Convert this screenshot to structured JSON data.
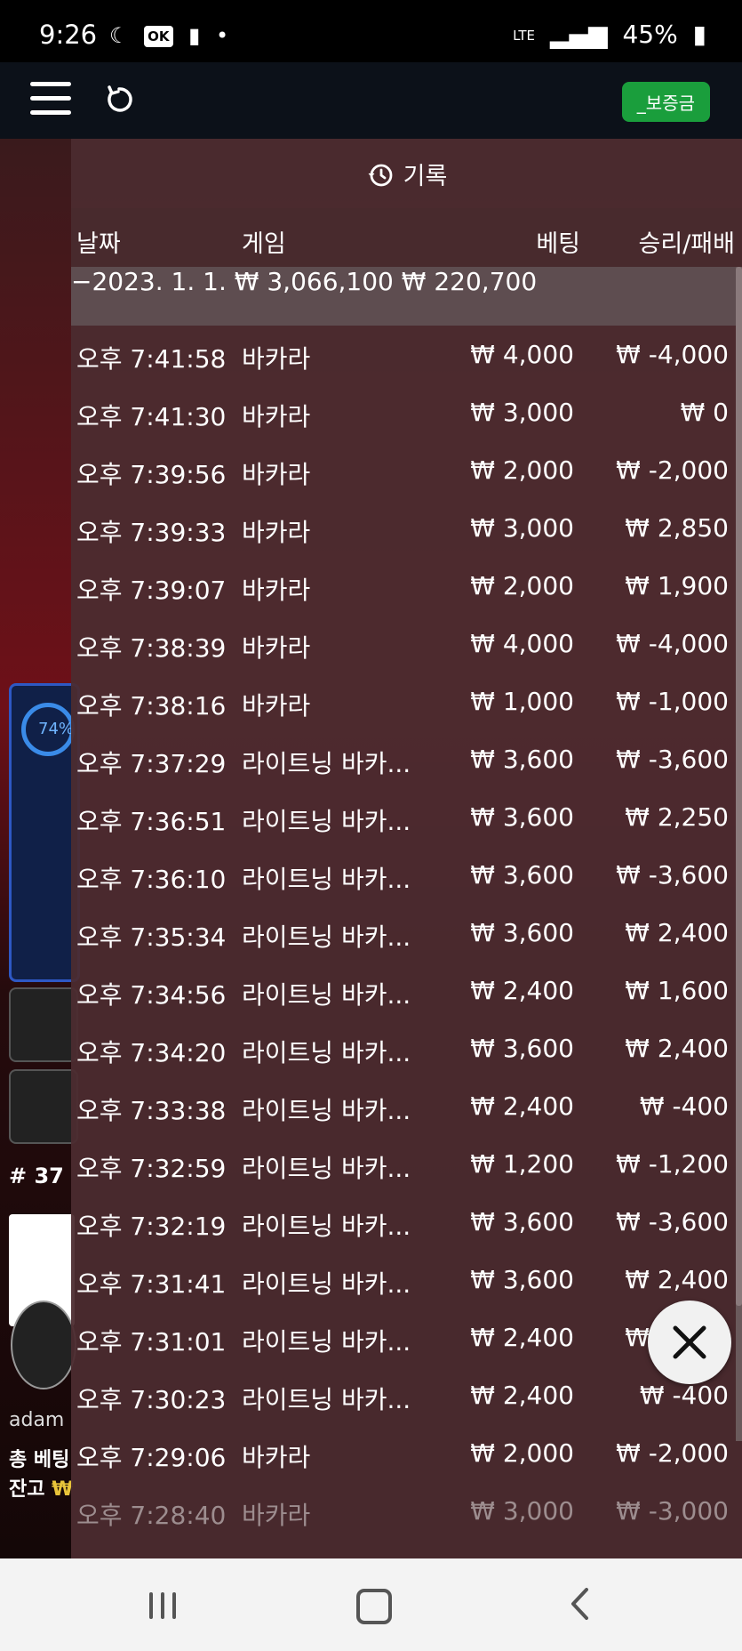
{
  "status_bar": {
    "time": "9:26",
    "icons_left": [
      "moon-icon",
      "ok-app-icon",
      "book-icon",
      "dot-icon"
    ],
    "ok_badge": "OK",
    "network": "LTE",
    "battery": "45%"
  },
  "app_bar": {
    "deposit_button": "_보증금"
  },
  "history": {
    "title": "기록",
    "columns": {
      "date": "날짜",
      "game": "게임",
      "bet": "베팅",
      "win_loss": "승리/패배"
    },
    "summary": {
      "date": "−2023. 1. 1.",
      "bet": "₩ 3,066,100",
      "win_loss": "₩ 220,700"
    },
    "rows": [
      {
        "time": "오후 7:41:58",
        "game": "바카라",
        "bet": "₩ 4,000",
        "result": "₩ -4,000"
      },
      {
        "time": "오후 7:41:30",
        "game": "바카라",
        "bet": "₩ 3,000",
        "result": "₩ 0"
      },
      {
        "time": "오후 7:39:56",
        "game": "바카라",
        "bet": "₩ 2,000",
        "result": "₩ -2,000"
      },
      {
        "time": "오후 7:39:33",
        "game": "바카라",
        "bet": "₩ 3,000",
        "result": "₩ 2,850"
      },
      {
        "time": "오후 7:39:07",
        "game": "바카라",
        "bet": "₩ 2,000",
        "result": "₩ 1,900"
      },
      {
        "time": "오후 7:38:39",
        "game": "바카라",
        "bet": "₩ 4,000",
        "result": "₩ -4,000"
      },
      {
        "time": "오후 7:38:16",
        "game": "바카라",
        "bet": "₩ 1,000",
        "result": "₩ -1,000"
      },
      {
        "time": "오후 7:37:29",
        "game": "라이트닝 바카...",
        "bet": "₩ 3,600",
        "result": "₩ -3,600"
      },
      {
        "time": "오후 7:36:51",
        "game": "라이트닝 바카...",
        "bet": "₩ 3,600",
        "result": "₩ 2,250"
      },
      {
        "time": "오후 7:36:10",
        "game": "라이트닝 바카...",
        "bet": "₩ 3,600",
        "result": "₩ -3,600"
      },
      {
        "time": "오후 7:35:34",
        "game": "라이트닝 바카...",
        "bet": "₩ 3,600",
        "result": "₩ 2,400"
      },
      {
        "time": "오후 7:34:56",
        "game": "라이트닝 바카...",
        "bet": "₩ 2,400",
        "result": "₩ 1,600"
      },
      {
        "time": "오후 7:34:20",
        "game": "라이트닝 바카...",
        "bet": "₩ 3,600",
        "result": "₩ 2,400"
      },
      {
        "time": "오후 7:33:38",
        "game": "라이트닝 바카...",
        "bet": "₩ 2,400",
        "result": "₩ -400"
      },
      {
        "time": "오후 7:32:59",
        "game": "라이트닝 바카...",
        "bet": "₩ 1,200",
        "result": "₩ -1,200"
      },
      {
        "time": "오후 7:32:19",
        "game": "라이트닝 바카...",
        "bet": "₩ 3,600",
        "result": "₩ -3,600"
      },
      {
        "time": "오후 7:31:41",
        "game": "라이트닝 바카...",
        "bet": "₩ 3,600",
        "result": "₩ 2,400"
      },
      {
        "time": "오후 7:31:01",
        "game": "라이트닝 바카...",
        "bet": "₩ 2,400",
        "result": "₩ 1,600"
      },
      {
        "time": "오후 7:30:23",
        "game": "라이트닝 바카...",
        "bet": "₩ 2,400",
        "result": "₩ -400"
      },
      {
        "time": "오후 7:29:06",
        "game": "바카라",
        "bet": "₩ 2,000",
        "result": "₩ -2,000"
      },
      {
        "time": "오후 7:28:40",
        "game": "바카라",
        "bet": "₩ 3,000",
        "result": "₩ -3,000"
      }
    ]
  },
  "background": {
    "percent": "74%",
    "round": "# 37",
    "username": "adam",
    "total_bet_label": "총 베팅",
    "balance_label": "잔고",
    "balance_symbol": "₩"
  },
  "colors": {
    "deposit_green": "#1a9e3c",
    "overlay": "#4b2c30",
    "summary_row": "#5e4d50",
    "app_bar": "#0c1119"
  }
}
